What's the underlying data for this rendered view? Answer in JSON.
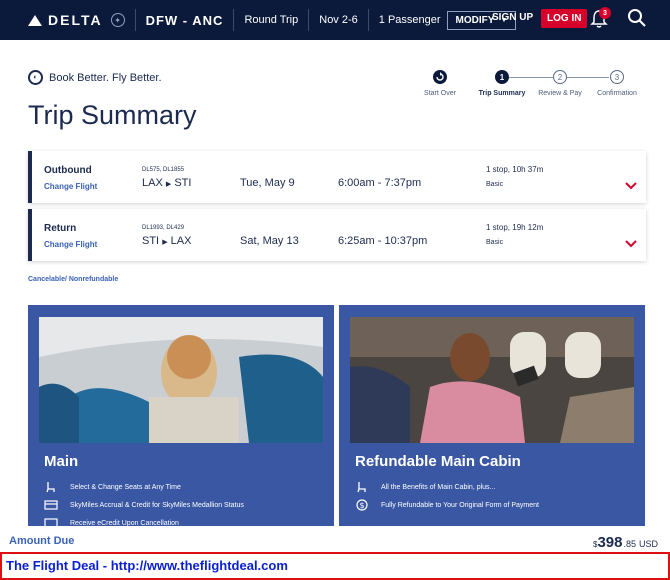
{
  "header": {
    "brand": "DELTA",
    "route": "DFW - ANC",
    "trip_type": "Round Trip",
    "dates": "Nov 2-6",
    "passengers": "1 Passenger",
    "modify_label": "MODIFY",
    "signup_label": "SIGN UP",
    "login_label": "LOG IN",
    "notification_count": "3",
    "brand_color": "#0b1a3a",
    "accent_color": "#d6002a"
  },
  "tagline": "Book Better. Fly Better.",
  "page_title": "Trip Summary",
  "steps": [
    {
      "label": "Start Over",
      "marker": ""
    },
    {
      "label": "Trip Summary",
      "marker": "1"
    },
    {
      "label": "Review & Pay",
      "marker": "2"
    },
    {
      "label": "Confirmation",
      "marker": "3"
    }
  ],
  "flights": [
    {
      "direction": "Outbound",
      "change_label": "Change Flight",
      "flight_numbers": "DL575, DL1855",
      "origin": "LAX",
      "destination": "STI",
      "date": "Tue, May 9",
      "times": "6:00am - 7:37pm",
      "stops": "1 stop, 10h 37m",
      "fare_class": "Basic"
    },
    {
      "direction": "Return",
      "change_label": "Change Flight",
      "flight_numbers": "DL1993, DL429",
      "origin": "STI",
      "destination": "LAX",
      "date": "Sat, May 13",
      "times": "6:25am - 10:37pm",
      "stops": "1 stop, 19h 12m",
      "fare_class": "Basic"
    }
  ],
  "cancel_policy": "Cancelable/ Nonrefundable",
  "fares": [
    {
      "title": "Main",
      "features": [
        {
          "icon": "seat-icon",
          "text": "Select & Change Seats at Any Time"
        },
        {
          "icon": "miles-icon",
          "text": "SkyMiles Accrual & Credit for SkyMiles Medallion Status"
        },
        {
          "icon": "ecredit-icon",
          "text": "Receive eCredit Upon Cancellation"
        }
      ]
    },
    {
      "title": "Refundable Main Cabin",
      "features": [
        {
          "icon": "seat-icon",
          "text": "All the Benefits of Main Cabin, plus..."
        },
        {
          "icon": "dollar-icon",
          "text": "Fully Refundable to Your Original Form of Payment"
        }
      ]
    }
  ],
  "amount_due": {
    "label": "Amount Due",
    "currency_symbol": "$",
    "dollars": "398",
    "cents": ".85",
    "currency": "USD"
  },
  "deal_banner": "The Flight Deal - http://www.theflightdeal.com"
}
